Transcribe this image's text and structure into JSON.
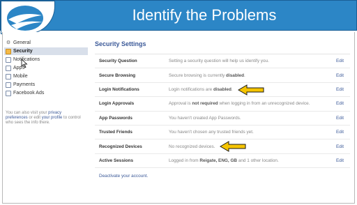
{
  "banner": {
    "title": "Identify the Problems"
  },
  "sidebar": {
    "items": [
      {
        "label": "General"
      },
      {
        "label": "Security"
      },
      {
        "label": "Notifications"
      },
      {
        "label": "Apps"
      },
      {
        "label": "Mobile"
      },
      {
        "label": "Payments"
      },
      {
        "label": "Facebook Ads"
      }
    ],
    "note_prefix": "You can also visit your ",
    "note_link1": "privacy preferences",
    "note_mid": " or edit ",
    "note_link2": "your profile",
    "note_suffix": " to control who sees the info there."
  },
  "main": {
    "title": "Security Settings",
    "edit_label": "Edit",
    "rows": [
      {
        "label": "Security Question",
        "desc": "Setting a security question will help us identify you."
      },
      {
        "label": "Secure Browsing",
        "desc_pre": "Secure browsing is currently ",
        "desc_bold": "disabled",
        "desc_post": "."
      },
      {
        "label": "Login Notifications",
        "desc_pre": "Login notifications are ",
        "desc_bold": "disabled",
        "desc_post": "."
      },
      {
        "label": "Login Approvals",
        "desc_pre": "Approval is ",
        "desc_bold": "not required",
        "desc_post": " when logging in from an unrecognized device."
      },
      {
        "label": "App Passwords",
        "desc": "You haven't created App Passwords."
      },
      {
        "label": "Trusted Friends",
        "desc": "You haven't chosen any trusted friends yet."
      },
      {
        "label": "Recognized Devices",
        "desc": "No recognized devices."
      },
      {
        "label": "Active Sessions",
        "desc_pre": "Logged in from ",
        "desc_bold": "Reigate, ENG, GB",
        "desc_post": " and 1 other location."
      }
    ],
    "deactivate": "Deactivate your account."
  },
  "colors": {
    "banner": "#2c86c6",
    "link": "#3b5998",
    "arrow": "#f5c400"
  }
}
